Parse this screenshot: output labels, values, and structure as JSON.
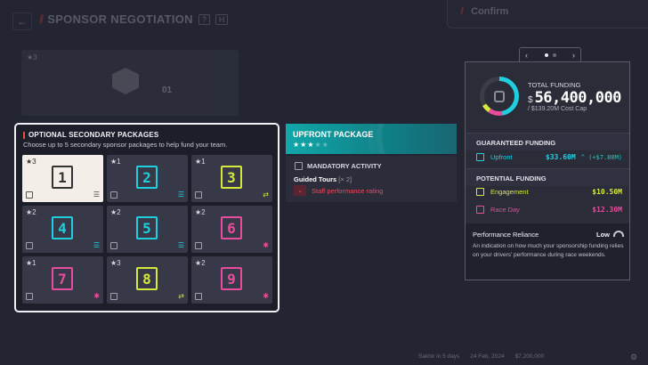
{
  "header": {
    "back_icon": "arrow-left-icon",
    "title": "SPONSOR NEGOTIATION",
    "help_key": "?",
    "hotkey": "H",
    "confirm_label": "Confirm"
  },
  "top_card": {
    "stars": "★3",
    "number": "01"
  },
  "packages": {
    "title": "OPTIONAL SECONDARY PACKAGES",
    "subtitle": "Choose up to 5 secondary sponsor packages to help fund your team.",
    "tiles": [
      {
        "stars": "★3",
        "number": "1",
        "color": "#333333",
        "type": "coins",
        "selected": true
      },
      {
        "stars": "★1",
        "number": "2",
        "color": "#1ecfe0",
        "type": "coins",
        "selected": false
      },
      {
        "stars": "★1",
        "number": "3",
        "color": "#d6e83a",
        "type": "exchange",
        "selected": false
      },
      {
        "stars": "★2",
        "number": "4",
        "color": "#1ecfe0",
        "type": "coins",
        "selected": false
      },
      {
        "stars": "★2",
        "number": "5",
        "color": "#1ecfe0",
        "type": "coins",
        "selected": false
      },
      {
        "stars": "★2",
        "number": "6",
        "color": "#e94c9c",
        "type": "race",
        "selected": false
      },
      {
        "stars": "★1",
        "number": "7",
        "color": "#e94c9c",
        "type": "race",
        "selected": false
      },
      {
        "stars": "★3",
        "number": "8",
        "color": "#d6e83a",
        "type": "exchange",
        "selected": false
      },
      {
        "stars": "★2",
        "number": "9",
        "color": "#e94c9c",
        "type": "race",
        "selected": false
      }
    ]
  },
  "upfront": {
    "title": "UPFRONT PACKAGE",
    "stars_on": "★★★",
    "stars_off": "★★",
    "mandatory_title": "MANDATORY ACTIVITY",
    "activity": "Guided Tours",
    "activity_count": "[× 2]",
    "performance_label": "Staff performance rating"
  },
  "funding": {
    "total_label": "TOTAL FUNDING",
    "currency": "$",
    "total_value": "56,400,000",
    "cost_cap": "/ $139.20M Cost Cap",
    "guaranteed_title": "GUARANTEED FUNDING",
    "upfront_label": "Upfront",
    "upfront_value": "$33.60M",
    "upfront_delta": "^ (+$7.80M)",
    "potential_title": "POTENTIAL FUNDING",
    "engagement_label": "Engagement",
    "engagement_value": "$10.50M",
    "raceday_label": "Race Day",
    "raceday_value": "$12.30M",
    "reliance_title": "Performance Reliance",
    "reliance_level": "Low",
    "reliance_desc": "An indication on how much your sponsorship funding relies on your drivers' performance during race weekends."
  },
  "pager": {
    "prev": "‹",
    "next": "›"
  },
  "status_bar": {
    "location": "Sakhir in 5 days",
    "date": "24 Feb, 2024",
    "balance": "$7,200,000"
  },
  "colors": {
    "cyan": "#1ecfe0",
    "lime": "#d6e83a",
    "pink": "#e94c9c",
    "red": "#e94c5c",
    "teal": "#11a7a9"
  }
}
